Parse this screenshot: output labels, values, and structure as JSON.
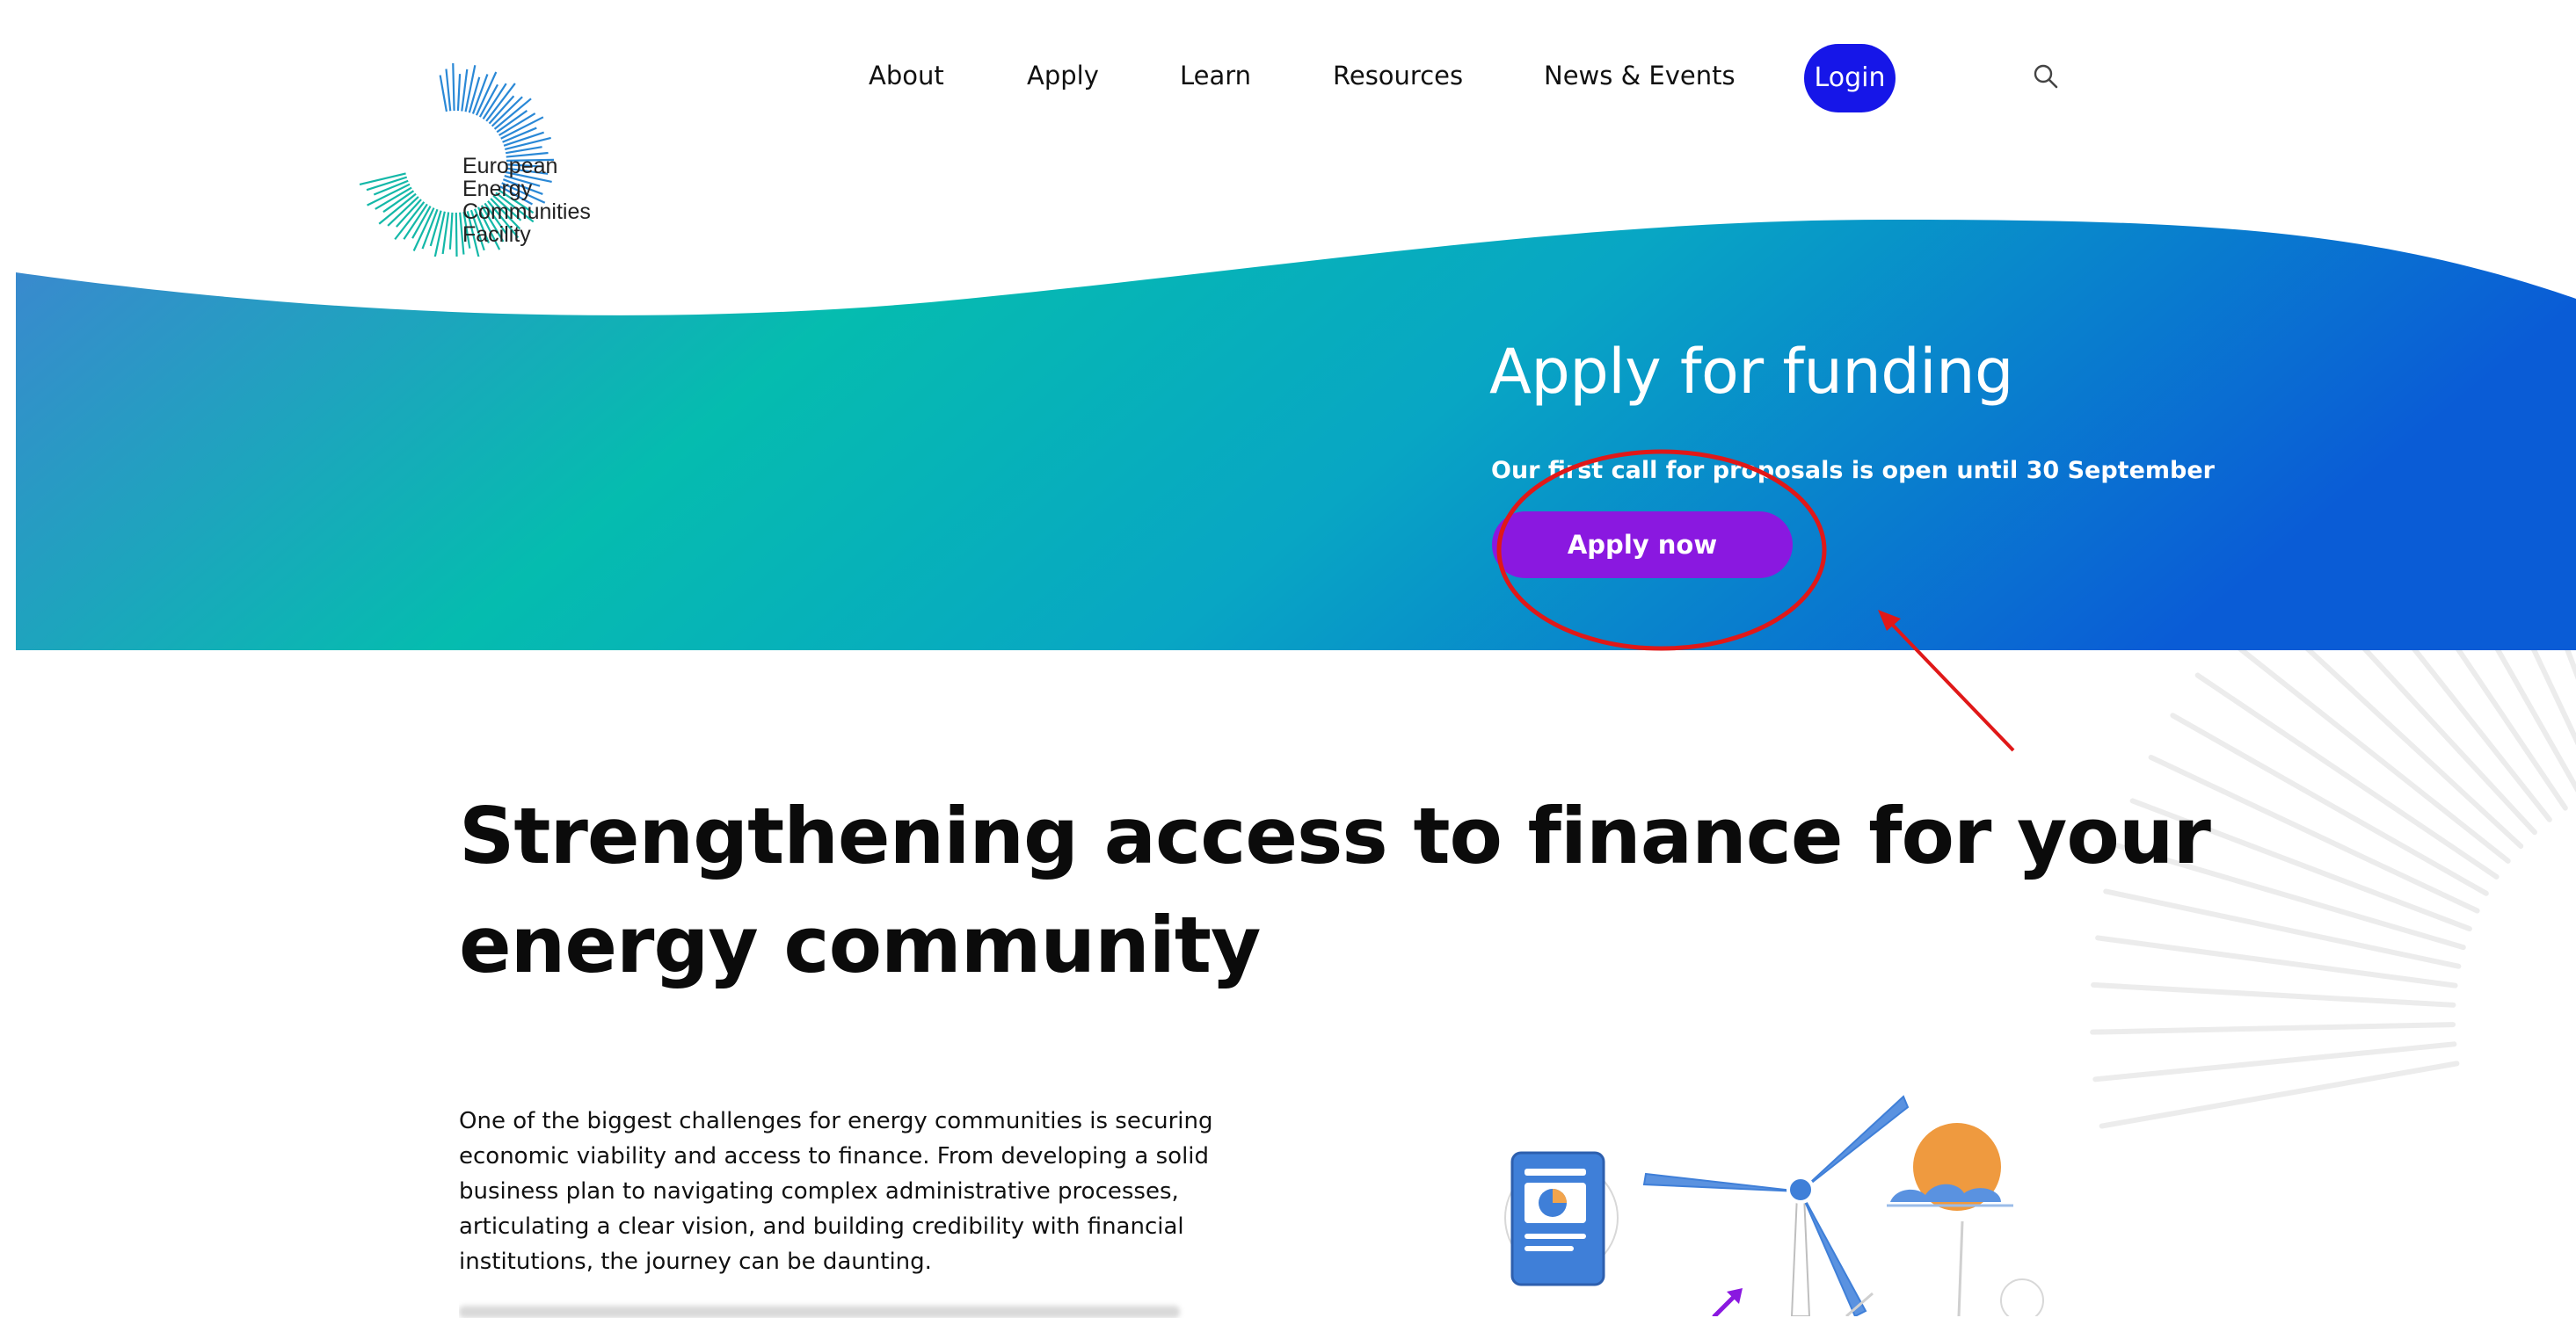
{
  "logo": {
    "lines": [
      "European",
      "Energy",
      "Communities",
      "Facility"
    ]
  },
  "nav": {
    "items": [
      "About",
      "Apply",
      "Learn",
      "Resources",
      "News & Events"
    ],
    "login": "Login",
    "search_icon": "search-icon"
  },
  "hero": {
    "title": "Apply for funding",
    "subtitle": "Our first call for proposals is open until 30 September",
    "cta": "Apply now"
  },
  "section": {
    "heading_lines": [
      "Strengthening access to finance for your",
      "energy community"
    ],
    "body_lines": [
      "One of the biggest challenges for energy communities is securing",
      "economic viability and access to finance. From developing a solid",
      "business plan to navigating complex administrative processes,",
      "articulating a clear vision, and building credibility with financial",
      "institutions, the journey can be daunting."
    ]
  },
  "colors": {
    "hero_gradient_left": "#3d86d0",
    "hero_gradient_mid": "#05b8b0",
    "hero_gradient_right": "#0a5cd6",
    "login_bg": "#1616e8",
    "cta_bg": "#8a18e0",
    "annotation": "#e01818"
  },
  "icons": [
    "search-icon",
    "sunburst-logo-icon",
    "wind-turbine-illustration",
    "document-chart-icon",
    "sun-icon",
    "cloud-icon"
  ]
}
